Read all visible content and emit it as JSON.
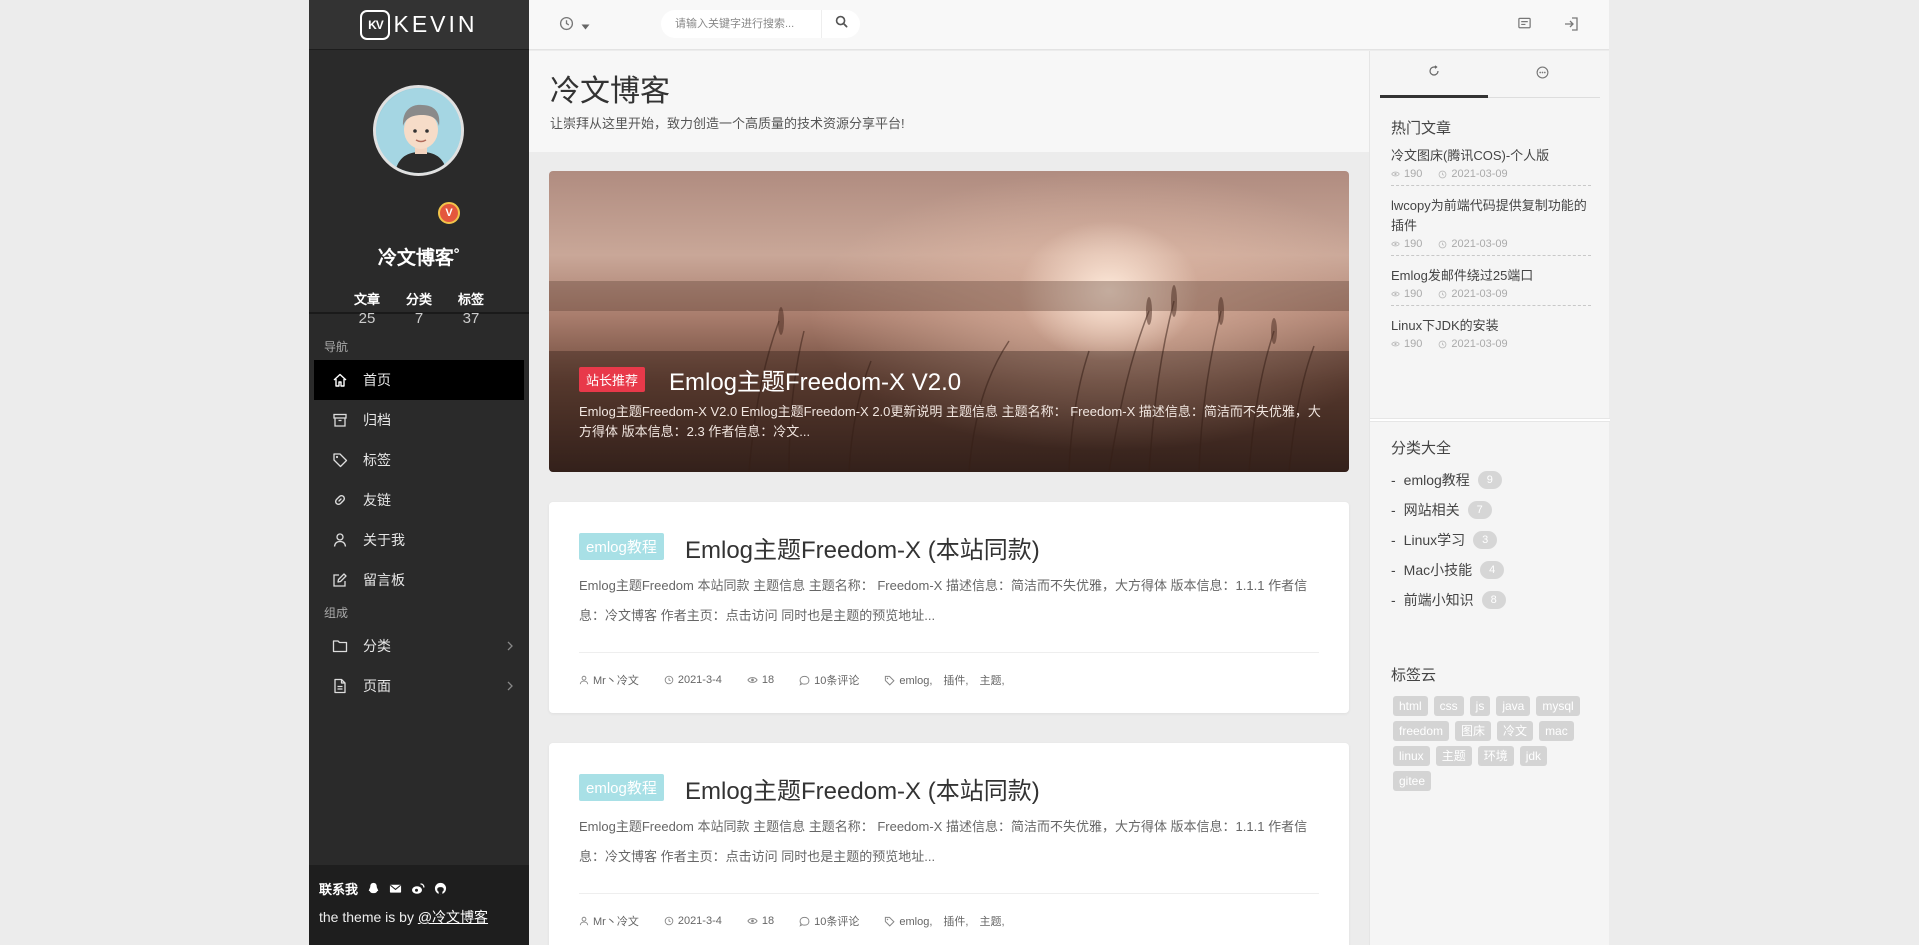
{
  "logo": {
    "box_text": "KV",
    "text": "KEVIN"
  },
  "profile": {
    "name": "冷文博客˚",
    "badge": "V",
    "stats": [
      {
        "label": "文章",
        "value": "25"
      },
      {
        "label": "分类",
        "value": "7"
      },
      {
        "label": "标签",
        "value": "37"
      }
    ]
  },
  "nav": {
    "section1": "导航",
    "items1": [
      {
        "label": "首页",
        "icon": "home-icon",
        "active": true
      },
      {
        "label": "归档",
        "icon": "archive-icon"
      },
      {
        "label": "标签",
        "icon": "tag-icon"
      },
      {
        "label": "友链",
        "icon": "link-icon"
      },
      {
        "label": "关于我",
        "icon": "user-icon"
      },
      {
        "label": "留言板",
        "icon": "edit-icon"
      }
    ],
    "section2": "组成",
    "items2": [
      {
        "label": "分类",
        "icon": "folder-icon"
      },
      {
        "label": "页面",
        "icon": "file-icon"
      }
    ]
  },
  "footer": {
    "contact_label": "联系我",
    "credit_prefix": "the theme is by ",
    "credit_link": "@冷文博客"
  },
  "search": {
    "placeholder": "请输入关键字进行搜索..."
  },
  "page": {
    "title": "冷文博客",
    "subtitle": "让崇拜从这里开始，致力创造一个高质量的技术资源分享平台!"
  },
  "hero": {
    "tag": "站长推荐",
    "title": "Emlog主题Freedom-X V2.0",
    "desc": "Emlog主题Freedom-X V2.0 Emlog主题Freedom-X 2.0更新说明 主题信息 主题名称： Freedom-X 描述信息：简洁而不失优雅，大方得体 版本信息：2.3 作者信息：冷文..."
  },
  "posts": [
    {
      "category": "emlog教程",
      "title": "Emlog主题Freedom-X (本站同款)",
      "desc": "Emlog主题Freedom 本站同款 主题信息 主题名称： Freedom-X 描述信息：简洁而不失优雅，大方得体 版本信息：1.1.1 作者信息：冷文博客 作者主页：点击访问 同时也是主题的预览地址...",
      "author": "Mr丶冷文",
      "date": "2021-3-4",
      "views": "18",
      "comments": "10条评论",
      "tags": "emlog,　插件,　主题,"
    },
    {
      "category": "emlog教程",
      "title": "Emlog主题Freedom-X (本站同款)",
      "desc": "Emlog主题Freedom 本站同款 主题信息 主题名称： Freedom-X 描述信息：简洁而不失优雅，大方得体 版本信息：1.1.1 作者信息：冷文博客 作者主页：点击访问 同时也是主题的预览地址...",
      "author": "Mr丶冷文",
      "date": "2021-3-4",
      "views": "18",
      "comments": "10条评论",
      "tags": "emlog,　插件,　主题,"
    }
  ],
  "right": {
    "hot_title": "热门文章",
    "hot": [
      {
        "title": "冷文图床(腾讯COS)-个人版",
        "views": "190",
        "date": "2021-03-09"
      },
      {
        "title": "lwcopy为前端代码提供复制功能的插件",
        "views": "190",
        "date": "2021-03-09"
      },
      {
        "title": "Emlog发邮件绕过25端口",
        "views": "190",
        "date": "2021-03-09"
      },
      {
        "title": "Linux下JDK的安装",
        "views": "190",
        "date": "2021-03-09"
      }
    ],
    "cat_title": "分类大全",
    "cats": [
      {
        "name": "emlog教程",
        "count": "9"
      },
      {
        "name": "网站相关",
        "count": "7"
      },
      {
        "name": "Linux学习",
        "count": "3"
      },
      {
        "name": "Mac小技能",
        "count": "4"
      },
      {
        "name": "前端小知识",
        "count": "8"
      }
    ],
    "tag_title": "标签云",
    "tags": [
      "html",
      "css",
      "js",
      "java",
      "mysql",
      "freedom",
      "图床",
      "冷文",
      "mac",
      "linux",
      "主题",
      "环境",
      "jdk",
      "gitee"
    ]
  }
}
